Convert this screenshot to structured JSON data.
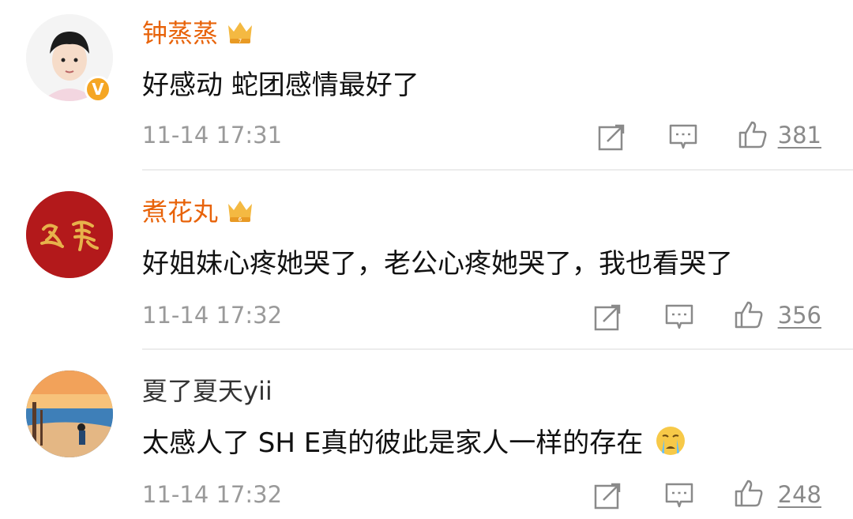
{
  "comments": [
    {
      "username": "钟蒸蒸",
      "crown_level": "7",
      "text": "好感动 蛇团感情最好了",
      "time": "11-14 17:31",
      "likes": "381",
      "verified_mark": "V",
      "avatar_icon": "young-man-portrait",
      "name_color": "#e8630a"
    },
    {
      "username": "煮花丸",
      "crown_level": "6",
      "text": "好姐妹心疼她哭了，老公心疼她哭了，我也看哭了",
      "time": "11-14 17:32",
      "likes": "356",
      "avatar_icon": "red-seal-calligraphy",
      "name_color": "#e8630a"
    },
    {
      "username": "夏了夏天yii",
      "text": "太感人了 SH E真的彼此是家人一样的存在",
      "emoji": "crying-face-emoji",
      "time": "11-14 17:32",
      "likes": "248",
      "avatar_icon": "sunset-beach-painting",
      "name_color": "#333333"
    }
  ],
  "icons": {
    "repost": "repost-icon",
    "comment": "comment-icon",
    "like": "thumbs-up-icon"
  },
  "colors": {
    "accent": "#e8630a",
    "muted": "#9a9a9a",
    "divider": "#ececec"
  }
}
